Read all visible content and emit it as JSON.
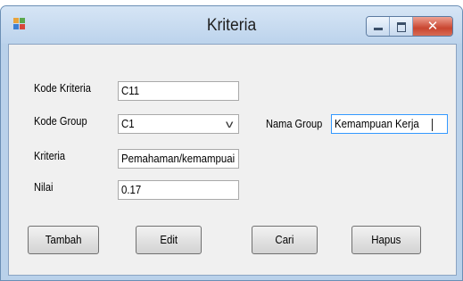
{
  "window": {
    "title": "Kriteria"
  },
  "form": {
    "kode_kriteria_label": "Kode Kriteria",
    "kode_kriteria_value": "C11",
    "kode_group_label": "Kode Group",
    "kode_group_value": "C1",
    "nama_group_label": "Nama Group",
    "nama_group_value": "Kemampuan Kerja",
    "kriteria_label": "Kriteria",
    "kriteria_value": "Pemahaman/kemampuai",
    "nilai_label": "Nilai",
    "nilai_value": "0.17"
  },
  "buttons": {
    "tambah": "Tambah",
    "edit": "Edit",
    "cari": "Cari",
    "hapus": "Hapus"
  },
  "colors": {
    "window_frame": "#b9d1ea",
    "client_bg": "#f0f0f0",
    "close_button": "#c94530",
    "focus_border": "#3399ff"
  }
}
